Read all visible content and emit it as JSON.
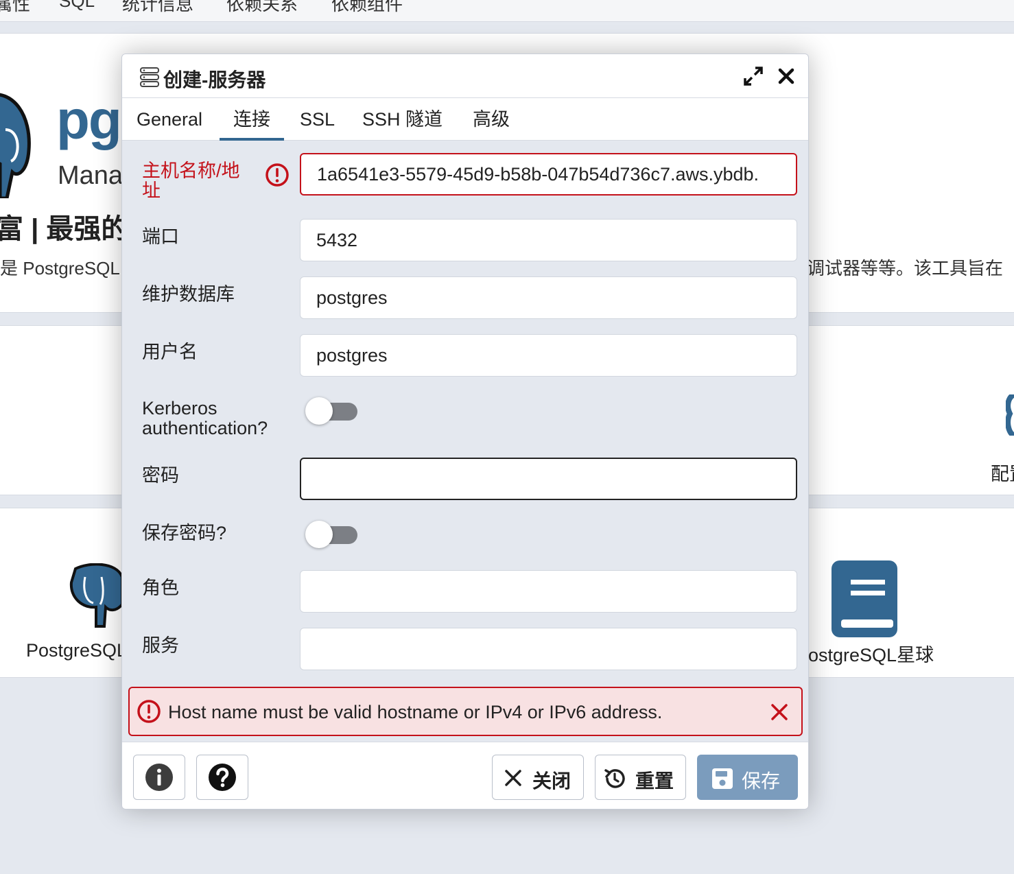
{
  "background": {
    "tabs": [
      "属性",
      "SQL",
      "统计信息",
      "依赖关系",
      "依赖组件"
    ],
    "logo_text": "pg",
    "logo_sub": "Mana",
    "tagline": "富 | 最强的",
    "description_left": "是 PostgreSQL",
    "description_right": "调试器等等。该工具旨在",
    "card_label_right_top": "配置",
    "card_postgresql": "PostgreSQL",
    "card_planet": "ostgreSQL星球"
  },
  "dialog": {
    "title": "创建-服务器",
    "tabs": [
      {
        "label": "General",
        "active": false
      },
      {
        "label": "连接",
        "active": true
      },
      {
        "label": "SSL",
        "active": false
      },
      {
        "label": "SSH 隧道",
        "active": false
      },
      {
        "label": "高级",
        "active": false
      }
    ],
    "fields": {
      "host": {
        "label": "主机名称/地址",
        "label_line1": "主机名称/地",
        "label_line2": "址",
        "value": "1a6541e3-5579-45d9-b58b-047b54d736c7.aws.ybdb."
      },
      "port": {
        "label": "端口",
        "value": "5432"
      },
      "maintenance_db": {
        "label": "维护数据库",
        "value": "postgres"
      },
      "username": {
        "label": "用户名",
        "value": "postgres"
      },
      "kerberos": {
        "label_line1": "Kerberos",
        "label_line2": "authentication?",
        "on": false
      },
      "password": {
        "label": "密码",
        "value": ""
      },
      "save_password": {
        "label": "保存密码?",
        "on": false
      },
      "role": {
        "label": "角色",
        "value": ""
      },
      "service": {
        "label": "服务",
        "value": ""
      }
    },
    "error_message": "Host name must be valid hostname or IPv4 or IPv6 address.",
    "footer": {
      "close_label": "关闭",
      "reset_label": "重置",
      "save_label": "保存"
    }
  },
  "colors": {
    "accent": "#326690",
    "error": "#c4111a",
    "error_bg": "#f8e1e2",
    "save_button": "#7b9cbd",
    "dialog_bg": "#e4e8ef"
  },
  "icons": [
    "server-icon",
    "expand-icon",
    "close-icon",
    "error-icon",
    "info-icon",
    "help-icon",
    "x-icon",
    "reset-icon",
    "save-icon",
    "elephant-icon",
    "book-icon"
  ]
}
